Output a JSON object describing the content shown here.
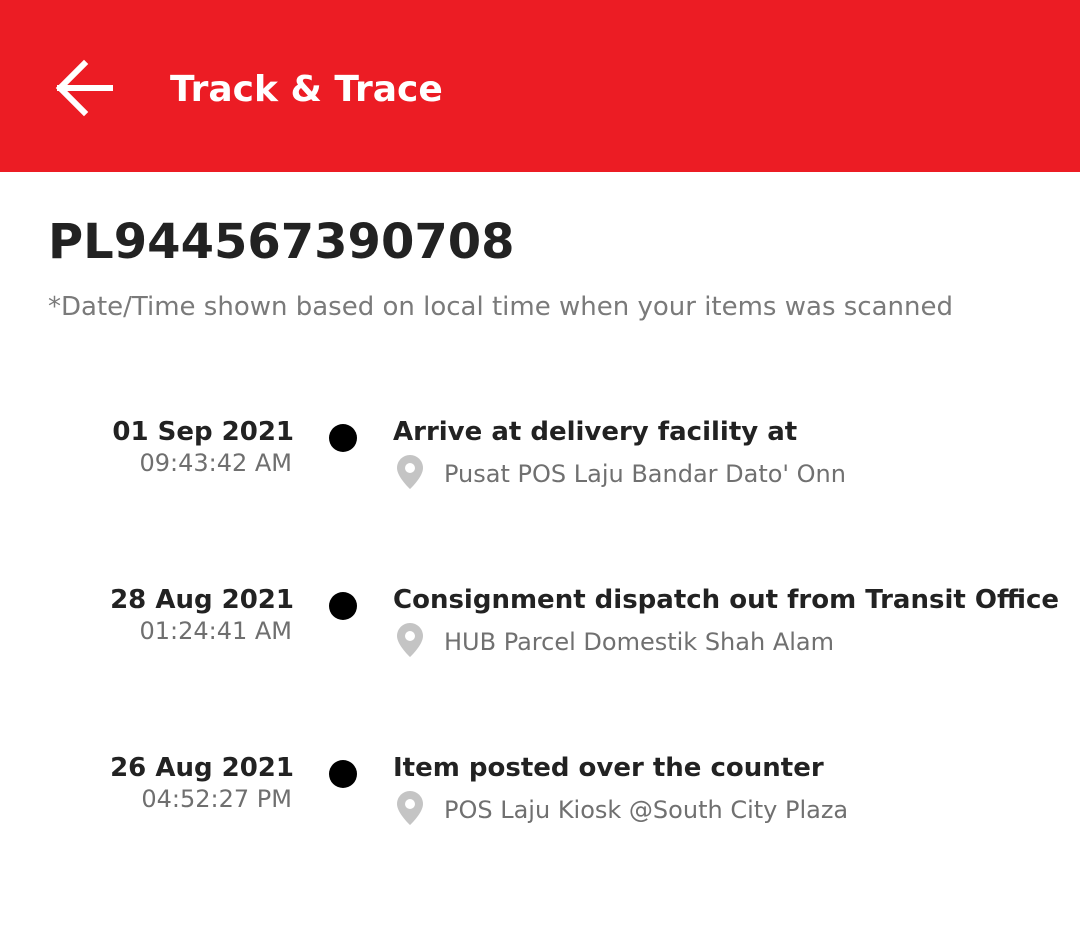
{
  "header": {
    "title": "Track & Trace",
    "back_icon": "arrow-left-icon",
    "background_color": "#ec1c24"
  },
  "tracking": {
    "number": "PL944567390708",
    "note": "*Date/Time shown based on local time when your items was scanned"
  },
  "events": [
    {
      "date": "01 Sep 2021",
      "time": "09:43:42 AM",
      "status": "Arrive at delivery facility at",
      "location": "Pusat POS Laju Bandar Dato' Onn"
    },
    {
      "date": "28 Aug 2021",
      "time": "01:24:41 AM",
      "status": "Consignment dispatch out from Transit Office",
      "location": "HUB Parcel Domestik Shah Alam"
    },
    {
      "date": "26 Aug 2021",
      "time": "04:52:27 PM",
      "status": "Item posted over the counter",
      "location": "POS Laju Kiosk @South City Plaza"
    }
  ],
  "icons": {
    "timeline_dot": "dot-icon",
    "location": "map-pin-icon"
  }
}
